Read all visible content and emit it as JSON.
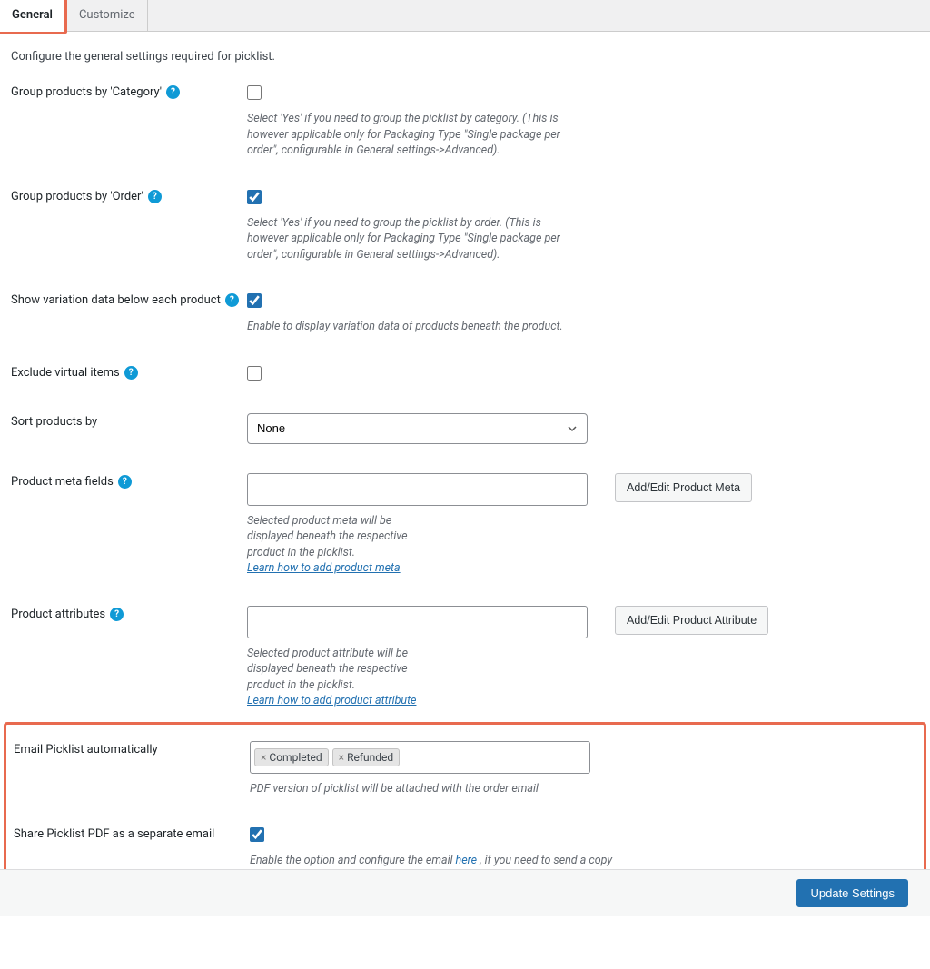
{
  "tabs": {
    "general": "General",
    "customize": "Customize"
  },
  "intro": "Configure the general settings required for picklist.",
  "settings": {
    "group_category": {
      "label": "Group products by 'Category'",
      "desc": "Select 'Yes' if you need to group the picklist by category. (This is however applicable only for Packaging Type \"Single package per order\", configurable in General settings->Advanced)."
    },
    "group_order": {
      "label": "Group products by 'Order'",
      "desc": "Select 'Yes' if you need to group the picklist by order. (This is however applicable only for Packaging Type \"Single package per order\", configurable in General settings->Advanced)."
    },
    "variation": {
      "label": "Show variation data below each product",
      "desc": "Enable to display variation data of products beneath the product."
    },
    "exclude_virtual": {
      "label": "Exclude virtual items"
    },
    "sort": {
      "label": "Sort products by",
      "value": "None"
    },
    "meta": {
      "label": "Product meta fields",
      "desc": "Selected product meta will be displayed beneath the respective product in the picklist.",
      "link": "Learn how to add product meta",
      "button": "Add/Edit Product Meta"
    },
    "attributes": {
      "label": "Product attributes",
      "desc": "Selected product attribute will be displayed beneath the respective product in the picklist.",
      "link": "Learn how to add product attribute",
      "button": "Add/Edit Product Attribute"
    },
    "email_auto": {
      "label": "Email Picklist automatically",
      "tag1": "Completed",
      "tag2": "Refunded",
      "desc": "PDF version of picklist will be attached with the order email"
    },
    "share_pdf": {
      "label": "Share Picklist PDF as a separate email",
      "desc_pre": "Enable the option and configure the email ",
      "desc_link": "here ",
      "desc_post": ", if you need to send a copy of the picklist to another email id e.g admin email."
    }
  },
  "footer": {
    "update": "Update Settings"
  }
}
